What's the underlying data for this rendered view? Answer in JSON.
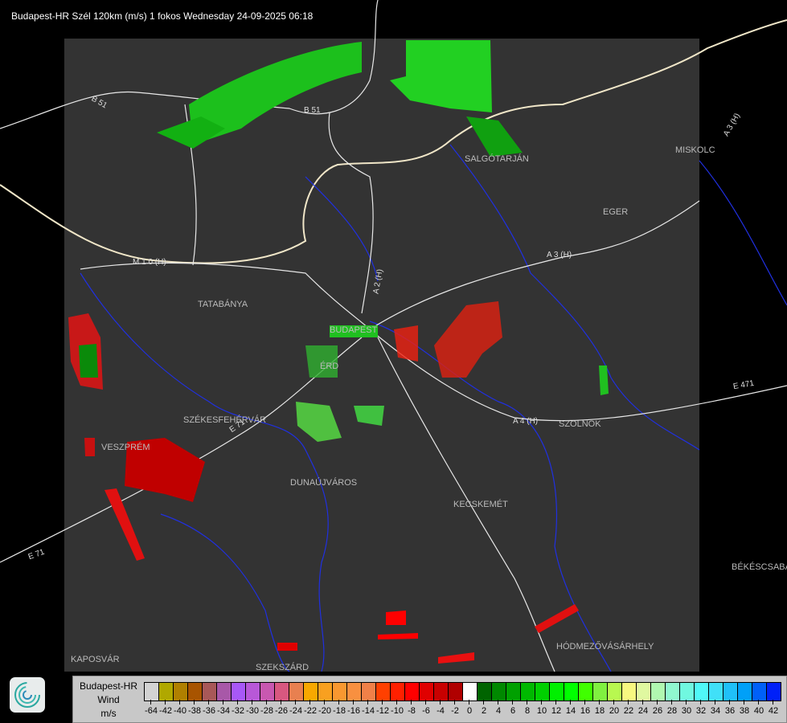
{
  "header": {
    "title": "Budapest-HR Szél 120km (m/s) 1 fokos Wednesday 24-09-2025 06:18"
  },
  "map": {
    "cities": [
      "SALGÓTARJÁN",
      "MISKOLC",
      "EGER",
      "TATABÁNYA",
      "BUDAPEST",
      "ÉRD",
      "SZÉKESFEHÉRVÁR",
      "VESZPRÉM",
      "DUNAÚJVÁROS",
      "KECSKEMÉT",
      "SZOLNOK",
      "BÉKÉSCSABA",
      "HÓDMEZŐVÁSÁRHELY",
      "KAPOSVÁR",
      "SZEKSZÁRD"
    ],
    "roads": [
      "B 51",
      "B 51",
      "A 3 (H)",
      "A 3 (H)",
      "M 1 0 (H)",
      "A 2 (H)",
      "E 71",
      "A 4 (H)",
      "E 471",
      "E 71"
    ]
  },
  "legend": {
    "name_lines": [
      "Budapest-HR",
      "Wind",
      "m/s"
    ],
    "labels": [
      "-64",
      "-42",
      "-40",
      "-38",
      "-36",
      "-34",
      "-32",
      "-30",
      "-28",
      "-26",
      "-24",
      "-22",
      "-20",
      "-18",
      "-16",
      "-14",
      "-12",
      "-10",
      "-8",
      "-6",
      "-4",
      "-2",
      "0",
      "2",
      "4",
      "6",
      "8",
      "10",
      "12",
      "14",
      "16",
      "18",
      "20",
      "22",
      "24",
      "26",
      "28",
      "30",
      "32",
      "34",
      "36",
      "38",
      "40",
      "42"
    ],
    "colors": [
      "#d3d3d3",
      "#b0a800",
      "#b08000",
      "#a85400",
      "#a85858",
      "#a858a8",
      "#a858f8",
      "#b858d8",
      "#c858b0",
      "#d85880",
      "#e88050",
      "#f8a800",
      "#f8a020",
      "#f89830",
      "#f89040",
      "#f08048",
      "#ff4000",
      "#ff2000",
      "#ff0000",
      "#e00000",
      "#c80000",
      "#b00000",
      "#ffffff",
      "#006400",
      "#008800",
      "#00a000",
      "#00b800",
      "#00d000",
      "#00f000",
      "#00ff00",
      "#40ff00",
      "#80f040",
      "#b8f850",
      "#f8f880",
      "#e0f8a0",
      "#b0f8b0",
      "#90f8d0",
      "#70f8e0",
      "#50f8f8",
      "#40e0f8",
      "#20c0f8",
      "#00a0f8",
      "#0060f8",
      "#0020f8"
    ]
  }
}
